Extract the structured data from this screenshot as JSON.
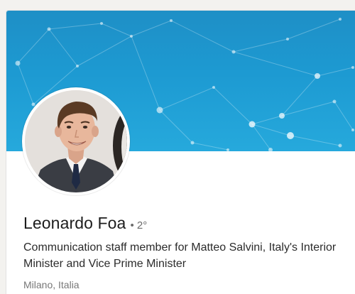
{
  "profile": {
    "name": "Leonardo Foa",
    "degree": "• 2°",
    "headline": "Communication staff member for Matteo Salvini, Italy's Interior Minister and Vice Prime Minister",
    "location": "Milano, Italia"
  },
  "icons": {
    "banner": "network-pattern",
    "avatar": "profile-photo"
  },
  "colors": {
    "banner": "#1d9ad2",
    "name": "#1d1d1d",
    "secondary_text": "#777777"
  }
}
